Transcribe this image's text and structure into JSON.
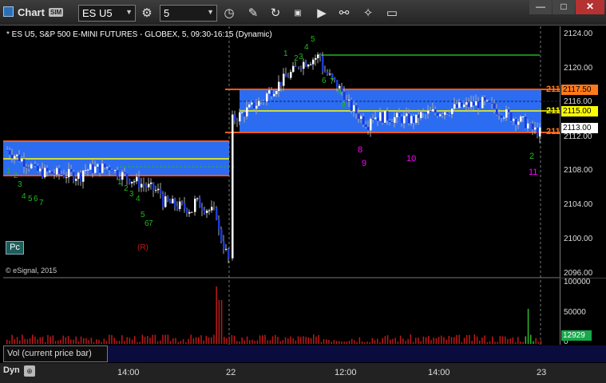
{
  "titlebar": {
    "title": "Chart",
    "badge": "SIM",
    "symbol": "ES U5",
    "interval": "5"
  },
  "chart": {
    "description": "* ES U5, S&P 500 E-MINI FUTURES - GLOBEX, 5, 09:30-16:15 (Dynamic)",
    "copyright": "© eSignal, 2015",
    "pc_button": "Pc",
    "r_label": "(R)"
  },
  "price_axis": {
    "ticks": [
      "2124.00",
      "2120.00",
      "2116.00",
      "2112.00",
      "2108.00",
      "2104.00",
      "2100.00",
      "2096.00"
    ],
    "tags": {
      "upper": "2117.50",
      "mid": "2115.00",
      "current": "2113.00",
      "cut_upper": "211",
      "cut_mid": "211",
      "cut_lower": "211"
    }
  },
  "volume_pane": {
    "label": "Vol (current price bar)",
    "ticks": [
      "100000",
      "50000",
      "0"
    ],
    "current": "12929"
  },
  "time_axis": {
    "dyn": "Dyn",
    "labels": [
      "14:00",
      "22",
      "12:00",
      "14:00",
      "23"
    ]
  },
  "setup_counts": {
    "green_1": [
      "1",
      "2",
      "3",
      "4",
      "5",
      "6",
      "7",
      "8",
      "9"
    ],
    "green_2": [
      "1",
      "2",
      "3",
      "4",
      "5",
      "6",
      "7",
      "8",
      "9"
    ],
    "green_3": [
      "1",
      "2",
      "3",
      "4",
      "5",
      "6",
      "7",
      "8",
      "9"
    ],
    "magenta": [
      "8",
      "9",
      "10",
      "11"
    ],
    "green_bottom": "2"
  },
  "colors": {
    "zone_blue": "#2c6cf0",
    "resistance": "#ff5a1a",
    "midline": "#ffff00",
    "green_line": "#1fb81f",
    "candle_up": "#ffffff",
    "candle_down": "#1b3bdc",
    "volume": "#c01818",
    "volume_high": "#2db82d"
  }
}
